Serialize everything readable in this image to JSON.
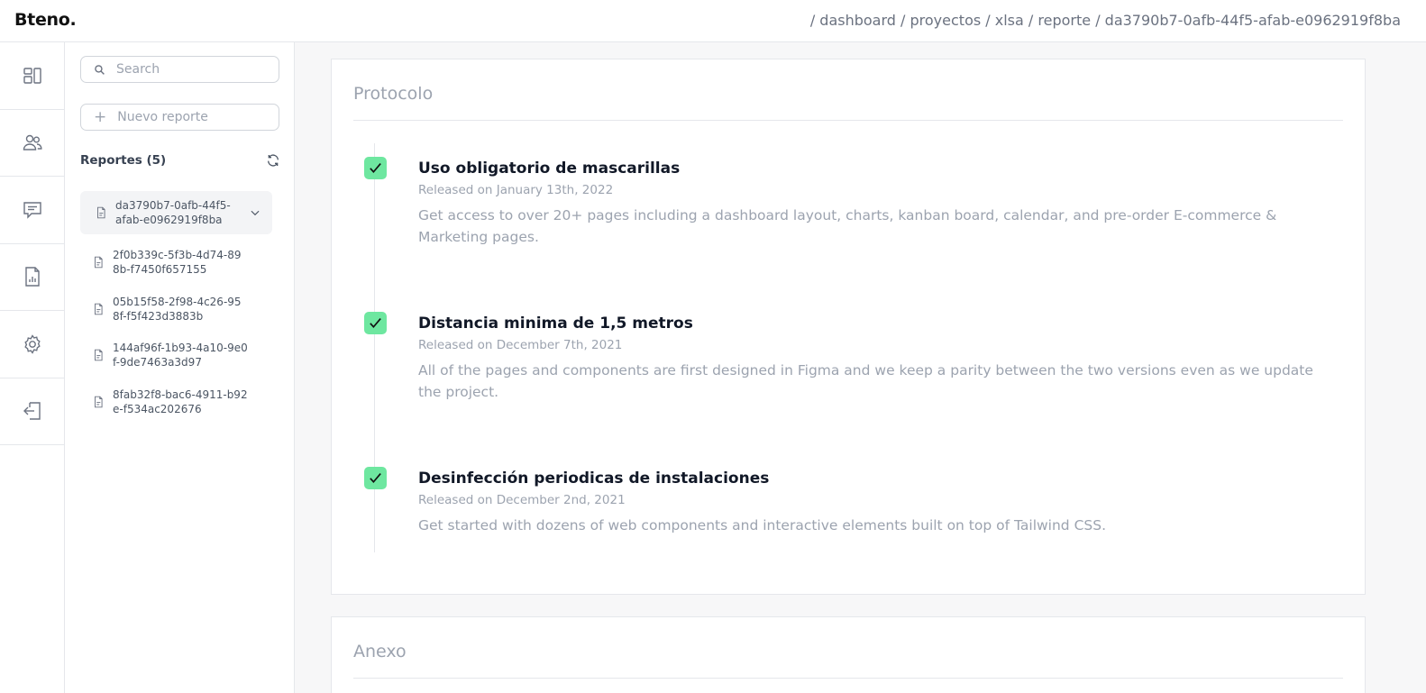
{
  "app": {
    "logo": "Bteno."
  },
  "breadcrumb": [
    "/ dashboard",
    "/ proyectos",
    "/ xlsa",
    "/ reporte",
    "/ da3790b7-0afb-44f5-afab-e0962919f8ba"
  ],
  "rail": [
    "dashboard-icon",
    "users-icon",
    "chat-icon",
    "report-icon",
    "settings-icon",
    "logout-icon"
  ],
  "sidebar": {
    "search_placeholder": "Search",
    "new_report_placeholder": "Nuevo reporte",
    "reports_title": "Reportes (5)",
    "files": [
      "da3790b7-0afb-44f5-afab-e0962919f8ba",
      "2f0b339c-5f3b-4d74-898b-f7450f657155",
      "05b15f58-2f98-4c26-958f-f5f423d3883b",
      "144af96f-1b93-4a10-9e0f-9de7463a3d97",
      "8fab32f8-bac6-4911-b92e-f534ac202676"
    ]
  },
  "protocol": {
    "title": "Protocolo",
    "items": [
      {
        "title": "Uso obligatorio de mascarillas",
        "date": "Released on January 13th, 2022",
        "desc": "Get access to over 20+ pages including a dashboard layout, charts, kanban board, calendar, and pre-order E-commerce & Marketing pages."
      },
      {
        "title": "Distancia minima de 1,5 metros",
        "date": "Released on December 7th, 2021",
        "desc": "All of the pages and components are first designed in Figma and we keep a parity between the two versions even as we update the project."
      },
      {
        "title": "Desinfección periodicas de instalaciones",
        "date": "Released on December 2nd, 2021",
        "desc": "Get started with dozens of web components and interactive elements built on top of Tailwind CSS."
      }
    ]
  },
  "annex": {
    "title": "Anexo"
  },
  "colors": {
    "check": "#6ee7a0",
    "muted": "#9ca3af",
    "border": "#e5e7eb"
  }
}
